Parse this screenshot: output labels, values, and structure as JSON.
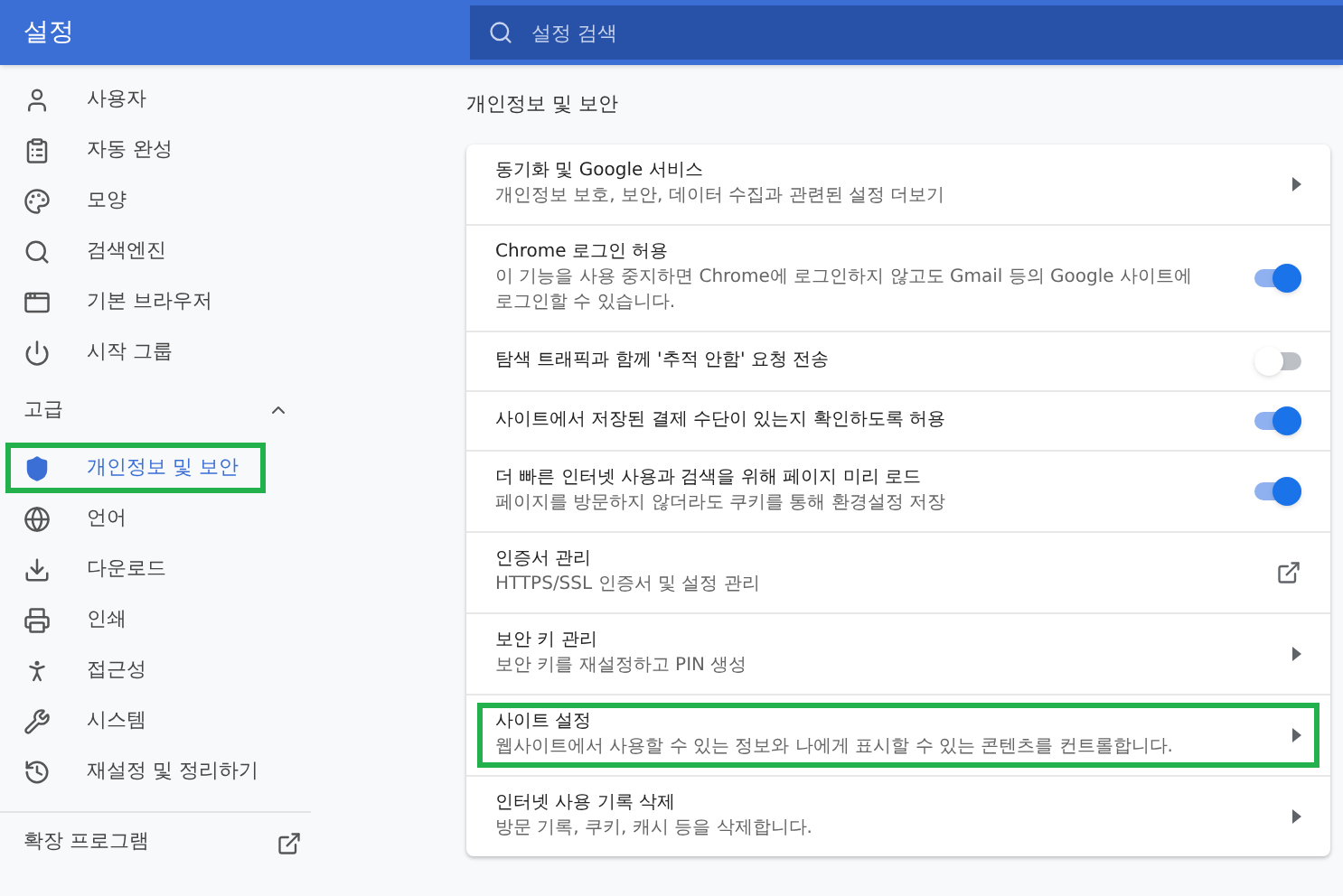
{
  "header": {
    "title": "설정",
    "search": {
      "placeholder": "설정 검색"
    }
  },
  "sidebar": {
    "items": [
      {
        "label": "사용자",
        "selected": false,
        "highlighted": false
      },
      {
        "label": "자동 완성",
        "selected": false,
        "highlighted": false
      },
      {
        "label": "모양",
        "selected": false,
        "highlighted": false
      },
      {
        "label": "검색엔진",
        "selected": false,
        "highlighted": false
      },
      {
        "label": "기본 브라우저",
        "selected": false,
        "highlighted": false
      },
      {
        "label": "시작 그룹",
        "selected": false,
        "highlighted": false
      }
    ],
    "advanced": {
      "label": "고급",
      "expanded": true,
      "items": [
        {
          "label": "개인정보 및 보안",
          "selected": true,
          "highlighted": true
        },
        {
          "label": "언어",
          "selected": false,
          "highlighted": false
        },
        {
          "label": "다운로드",
          "selected": false,
          "highlighted": false
        },
        {
          "label": "인쇄",
          "selected": false,
          "highlighted": false
        },
        {
          "label": "접근성",
          "selected": false,
          "highlighted": false
        },
        {
          "label": "시스템",
          "selected": false,
          "highlighted": false
        },
        {
          "label": "재설정 및 정리하기",
          "selected": false,
          "highlighted": false
        }
      ]
    },
    "extensions": {
      "label": "확장 프로그램"
    }
  },
  "section": {
    "title": "개인정보 및 보안",
    "rows": [
      {
        "kind": "arrow",
        "title": "동기화 및 Google 서비스",
        "subtitle": "개인정보 보호, 보안, 데이터 수집과 관련된 설정 더보기",
        "highlighted": false
      },
      {
        "kind": "toggle",
        "title": "Chrome 로그인 허용",
        "subtitle": "이 기능을 사용 중지하면 Chrome에 로그인하지 않고도 Gmail 등의 Google 사이트에 로그인할 수 있습니다.",
        "on": true,
        "highlighted": false
      },
      {
        "kind": "toggle",
        "title": "탐색 트래픽과 함께 '추적 안함' 요청 전송",
        "on": false,
        "highlighted": false
      },
      {
        "kind": "toggle",
        "title": "사이트에서 저장된 결제 수단이 있는지 확인하도록 허용",
        "on": true,
        "highlighted": false
      },
      {
        "kind": "toggle",
        "title": "더 빠른 인터넷 사용과 검색을 위해 페이지 미리 로드",
        "subtitle": "페이지를 방문하지 않더라도 쿠키를 통해 환경설정 저장",
        "on": true,
        "highlighted": false
      },
      {
        "kind": "external",
        "title": "인증서 관리",
        "subtitle": "HTTPS/SSL 인증서 및 설정 관리",
        "highlighted": false
      },
      {
        "kind": "arrow",
        "title": "보안 키 관리",
        "subtitle": "보안 키를 재설정하고 PIN 생성",
        "highlighted": false
      },
      {
        "kind": "arrow",
        "title": "사이트 설정",
        "subtitle": "웹사이트에서 사용할 수 있는 정보와 나에게 표시할 수 있는 콘텐츠를 컨트롤합니다.",
        "highlighted": true
      },
      {
        "kind": "arrow",
        "title": "인터넷 사용 기록 삭제",
        "subtitle": "방문 기록, 쿠키, 캐시 등을 삭제합니다.",
        "highlighted": false
      }
    ]
  }
}
